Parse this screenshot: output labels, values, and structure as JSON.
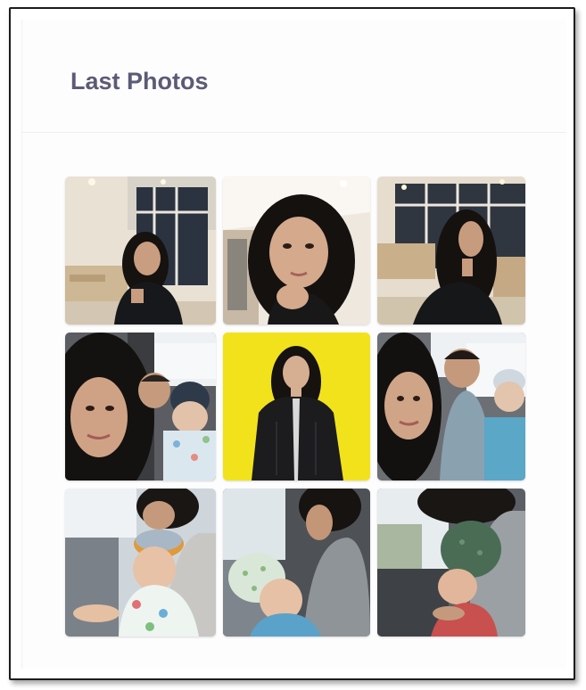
{
  "widget": {
    "title": "Last Photos"
  },
  "photos": [
    {
      "alt": "photo-1"
    },
    {
      "alt": "photo-2"
    },
    {
      "alt": "photo-3"
    },
    {
      "alt": "photo-4"
    },
    {
      "alt": "photo-5"
    },
    {
      "alt": "photo-6"
    },
    {
      "alt": "photo-7"
    },
    {
      "alt": "photo-8"
    },
    {
      "alt": "photo-9"
    }
  ],
  "colors": {
    "title": "#5b5b75",
    "divider": "#eceef3",
    "yellow_backdrop": "#f2e21c"
  }
}
